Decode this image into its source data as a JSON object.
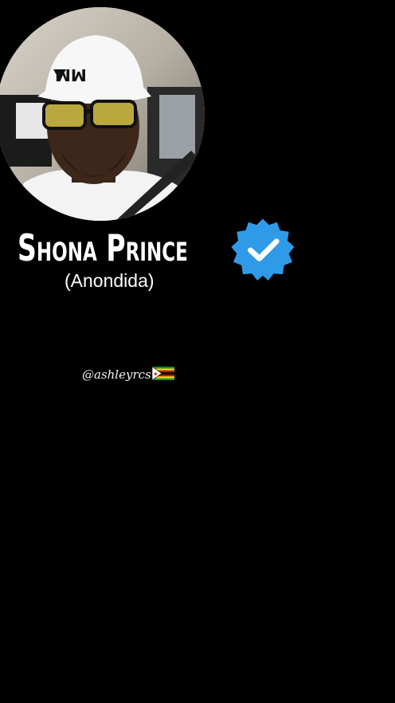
{
  "profile": {
    "display_name": "Shona Prince",
    "subtitle": "(Anondida)",
    "handle": "@ashleyrcs",
    "verified": true,
    "avatar_icon": "profile-photo",
    "flag_icon": "zimbabwe-flag-icon"
  },
  "colors": {
    "background": "#000000",
    "text": "#ffffff",
    "verified_badge": "#2f9ae8"
  }
}
